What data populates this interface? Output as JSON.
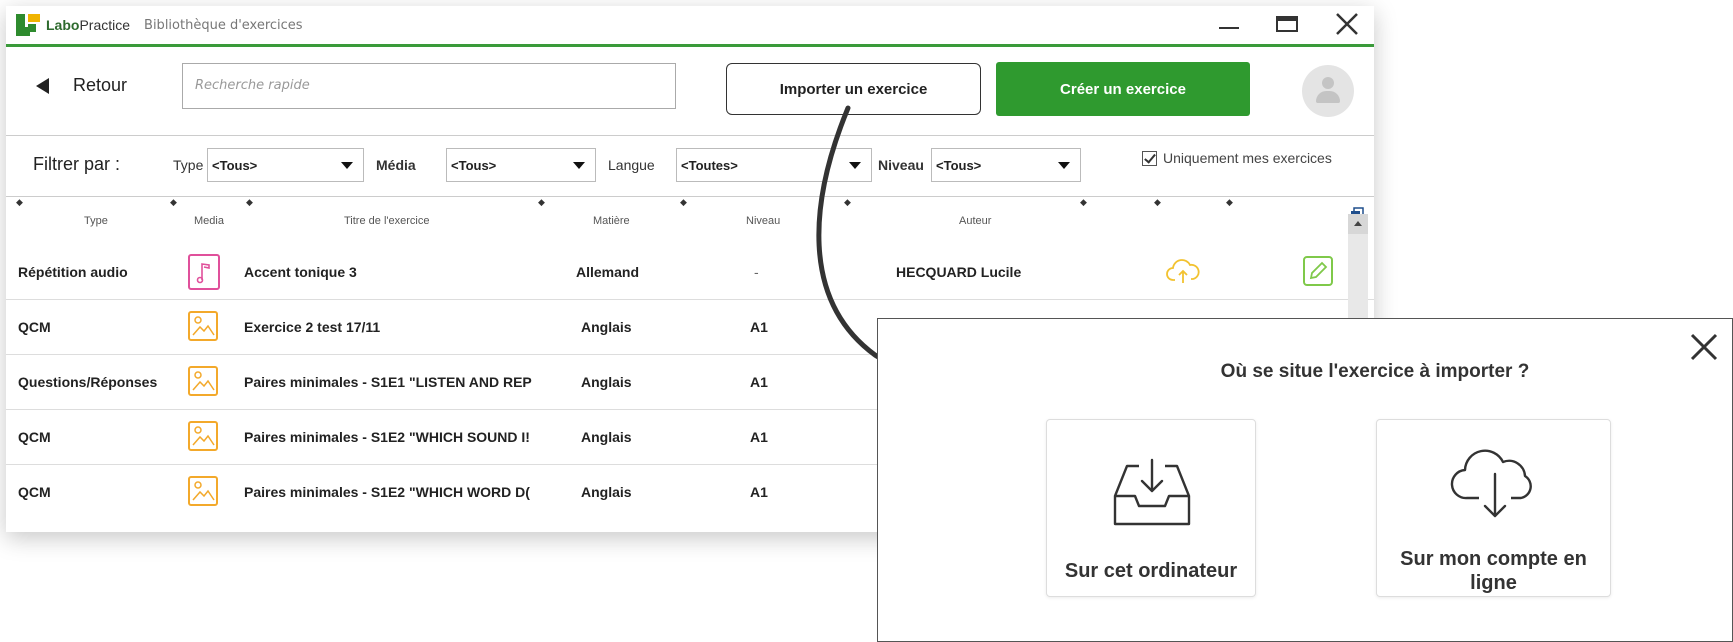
{
  "app": {
    "name_bold": "Labo",
    "name_rest": "Practice",
    "breadcrumb": "Bibliothèque d'exercices"
  },
  "toolbar": {
    "back_label": "Retour",
    "search_placeholder": "Recherche rapide",
    "import_label": "Importer un exercice",
    "create_label": "Créer un exercice"
  },
  "filters": {
    "label": "Filtrer par :",
    "type": {
      "label": "Type",
      "value": "<Tous>"
    },
    "media": {
      "label": "Média",
      "value": "<Tous>"
    },
    "langue": {
      "label": "Langue",
      "value": "<Toutes>"
    },
    "niveau": {
      "label": "Niveau",
      "value": "<Tous>"
    },
    "only_mine": {
      "label": "Uniquement mes exercices",
      "checked": true
    }
  },
  "table": {
    "headers": {
      "type": "Type",
      "media": "Media",
      "title": "Titre de l'exercice",
      "subject": "Matière",
      "level": "Niveau",
      "author": "Auteur"
    },
    "rows": [
      {
        "type": "Répétition audio",
        "media": "audio",
        "title": "Accent tonique 3",
        "subject": "Allemand",
        "level": "-",
        "author": "HECQUARD Lucile"
      },
      {
        "type": "QCM",
        "media": "image",
        "title": "Exercice 2 test 17/11",
        "subject": "Anglais",
        "level": "A1",
        "author": ""
      },
      {
        "type": "Questions/Réponses",
        "media": "image",
        "title": "Paires minimales - S1E1 \"LISTEN AND REP",
        "subject": "Anglais",
        "level": "A1",
        "author": ""
      },
      {
        "type": "QCM",
        "media": "image",
        "title": "Paires minimales - S1E2 \"WHICH SOUND I!",
        "subject": "Anglais",
        "level": "A1",
        "author": ""
      },
      {
        "type": "QCM",
        "media": "image",
        "title": "Paires minimales - S1E2 \"WHICH WORD D(",
        "subject": "Anglais",
        "level": "A1",
        "author": ""
      }
    ]
  },
  "dialog": {
    "title": "Où se situe l'exercice à importer ?",
    "option_local": "Sur cet ordinateur",
    "option_cloud_line1": "Sur mon compte en",
    "option_cloud_line2": "ligne"
  },
  "colors": {
    "accent_green": "#2f9a2f",
    "audio_pink": "#e0509b",
    "image_orange": "#f3a92b",
    "cloud_yellow": "#f2c230",
    "edit_green": "#7fc94a"
  }
}
